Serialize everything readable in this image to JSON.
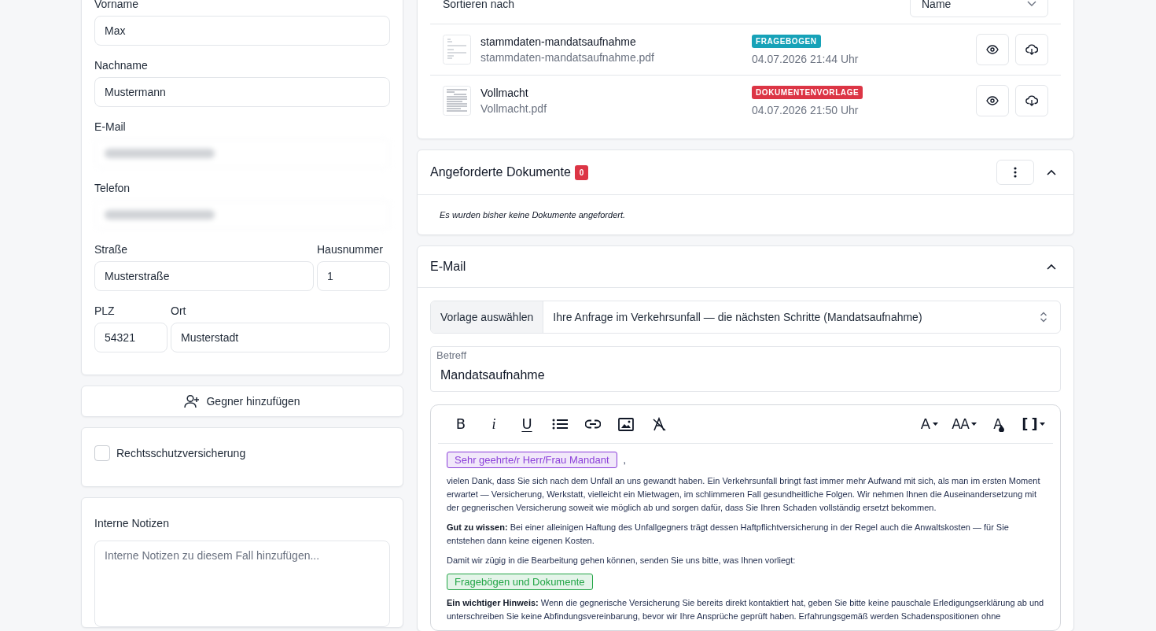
{
  "contact_form": {
    "rows": [
      [
        {
          "label": "Vorname",
          "kind": "text",
          "value": "Max"
        }
      ],
      [
        {
          "label": "Nachname",
          "kind": "text",
          "value": "Mustermann"
        }
      ],
      [
        {
          "label": "E-Mail",
          "kind": "blurred"
        }
      ],
      [
        {
          "label": "Telefon",
          "kind": "blurred"
        }
      ],
      [
        {
          "label": "Straße",
          "kind": "text",
          "value": "Musterstraße"
        },
        {
          "label": "Hausnummer",
          "kind": "text",
          "value": "1"
        }
      ],
      [
        {
          "label": "PLZ",
          "kind": "text",
          "value": "54321"
        },
        {
          "label": "Ort",
          "kind": "text",
          "value": "Musterstadt"
        }
      ]
    ]
  },
  "add_opponent_button": "Gegner hinzufügen",
  "legal_insurance": {
    "label": "Rechtsschutzversicherung",
    "checked": false
  },
  "internal_notes": {
    "label": "Interne Notizen",
    "placeholder": "Interne Notizen zu diesem Fall hinzufügen..."
  },
  "documents": {
    "sort_label": "Sortieren nach",
    "sort_value": "Name",
    "rows": [
      {
        "title": "stammdaten-mandatsaufnahme",
        "filename": "stammdaten-mandatsaufnahme.pdf",
        "tag": "FRAGEBOGEN",
        "color": "#17a2b8",
        "date": "04.07.2026 21:44 Uhr"
      },
      {
        "title": "Vollmacht",
        "filename": "Vollmacht.pdf",
        "tag": "DOKUMENTENVORLAGE",
        "color": "#dc3545",
        "date": "04.07.2026 21:50 Uhr"
      }
    ]
  },
  "requested_documents": {
    "title": "Angeforderte Dokumente",
    "count": "0",
    "expanded": true,
    "empty_text": "Es wurden bisher keine Dokumente angefordert."
  },
  "email": {
    "title": "E-Mail",
    "expanded": true,
    "template_label": "Vorlage auswählen",
    "template_value": "Ihre Anfrage im Verkehrsunfall — die nächsten Schritte (Mandatsaufnahme)",
    "subject_label": "Betreff",
    "subject_value": "Mandatsaufnahme",
    "toolbar": [
      {
        "kind": "bold",
        "label": "B"
      },
      {
        "kind": "italic",
        "label": "i"
      },
      {
        "kind": "underline",
        "label": "U"
      },
      {
        "kind": "list"
      },
      {
        "kind": "link"
      },
      {
        "kind": "image"
      },
      {
        "kind": "clear"
      },
      {
        "kind": "font",
        "label": "A"
      },
      {
        "kind": "size",
        "label": "AA"
      },
      {
        "kind": "color",
        "label": "A"
      },
      {
        "kind": "placeholder",
        "label": "[ ]"
      }
    ],
    "body": [
      {
        "kind": "chip",
        "text": "Sehr geehrte/r Herr/Frau Mandant",
        "color": "#8b3fd9",
        "suffix": ","
      },
      {
        "kind": "paragraph",
        "text": "vielen Dank, dass Sie sich nach dem Unfall an uns gewandt haben. Ein Verkehrsunfall bringt fast immer mehr Aufwand mit sich, als man im ersten Moment erwartet — Versicherung, Werkstatt, vielleicht ein Mietwagen, im schlimmeren Fall gesundheitliche Folgen. Wir nehmen Ihnen die Auseinandersetzung mit der gegnerischen Versicherung soweit wie möglich ab und sorgen dafür, dass Sie Ihren Schaden vollständig ersetzt bekommen."
      },
      {
        "kind": "paragraph",
        "text": "**Gut zu wissen:** Bei einer alleinigen Haftung des Unfallgegners trägt dessen Haftpflichtversicherung in der Regel auch die Anwaltskosten — für Sie entstehen dann keine eigenen Kosten."
      },
      {
        "kind": "paragraph",
        "text": "Damit wir zügig in die Bearbeitung gehen können, senden Sie uns bitte, was Ihnen vorliegt:"
      },
      {
        "kind": "chip",
        "text": "Fragebögen und Dokumente",
        "color": "#22a546"
      },
      {
        "kind": "paragraph",
        "text": "**Ein wichtiger Hinweis:** Wenn die gegnerische Versicherung Sie bereits direkt kontaktiert hat, geben Sie bitte keine pauschale Erledigungserklärung ab und unterschreiben Sie keine Abfindungsvereinbarung, bevor wir Ihre Ansprüche geprüft haben. Erfahrungsgemäß werden Schadenspositionen ohne"
      }
    ]
  }
}
